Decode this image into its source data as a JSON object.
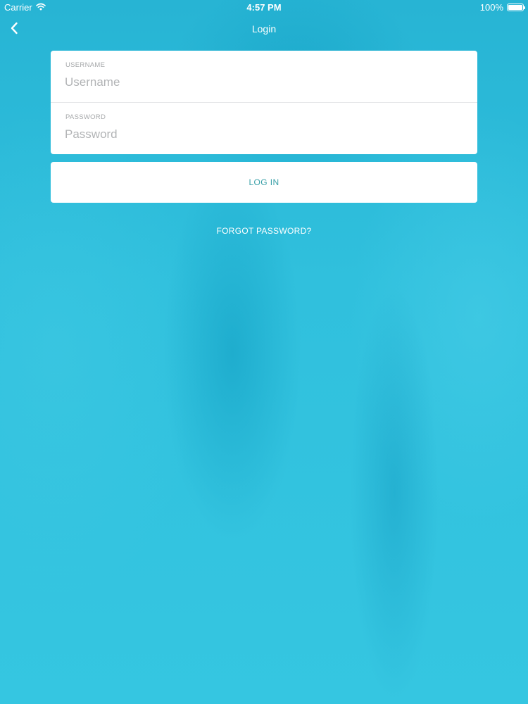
{
  "status_bar": {
    "carrier": "Carrier",
    "time": "4:57 PM",
    "battery_text": "100%",
    "battery_level": 1.0,
    "wifi_icon": "wifi-icon",
    "battery_icon": "battery-icon"
  },
  "nav": {
    "title": "Login",
    "back_icon": "chevron-left-icon"
  },
  "form": {
    "username": {
      "label": "USERNAME",
      "placeholder": "Username",
      "value": ""
    },
    "password": {
      "label": "PASSWORD",
      "placeholder": "Password",
      "value": ""
    }
  },
  "login_button": {
    "label": "LOG IN"
  },
  "forgot_password": {
    "label": "FORGOT PASSWORD?"
  },
  "colors": {
    "background": "#33c3df",
    "card": "#ffffff",
    "button_text": "#3aa0a8",
    "label_text": "#a6a8aa",
    "placeholder_text": "#b2b4b6"
  }
}
